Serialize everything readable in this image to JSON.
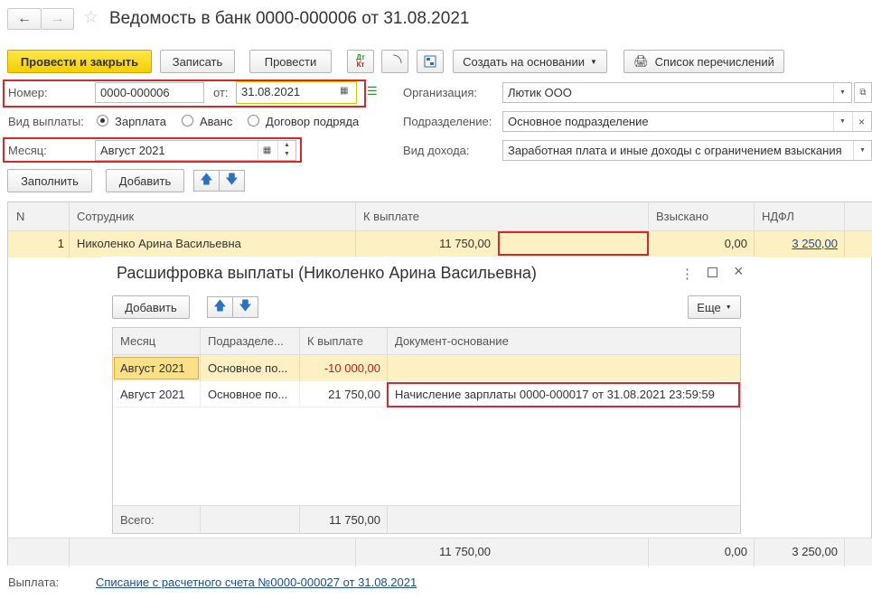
{
  "header": {
    "title": "Ведомость в банк 0000-000006 от 31.08.2021"
  },
  "toolbar": {
    "post_close": "Провести и закрыть",
    "save": "Записать",
    "post": "Провести",
    "dt_kt": "Дт Кт",
    "create_based": "Создать на основании",
    "transfer_list": "Список перечислений"
  },
  "form": {
    "number_label": "Номер:",
    "number_value": "0000-000006",
    "date_label": "от:",
    "date_value": "31.08.2021",
    "payment_type_label": "Вид выплаты:",
    "payment_options": [
      "Зарплата",
      "Аванс",
      "Договор подряда"
    ],
    "month_label": "Месяц:",
    "month_value": "Август 2021",
    "org_label": "Организация:",
    "org_value": "Лютик ООО",
    "dept_label": "Подразделение:",
    "dept_value": "Основное подразделение",
    "income_label": "Вид дохода:",
    "income_value": "Заработная плата и иные доходы с ограничением взыскания"
  },
  "tablebar": {
    "fill": "Заполнить",
    "add": "Добавить"
  },
  "main_table": {
    "headers": [
      "N",
      "Сотрудник",
      "К выплате",
      "Взыскано",
      "НДФЛ"
    ],
    "rows": [
      {
        "n": "1",
        "employee": "Николенко Арина Васильевна",
        "to_pay": "11 750,00",
        "collected": "0,00",
        "ndfl": "3 250,00"
      }
    ],
    "footer": {
      "to_pay": "11 750,00",
      "collected": "0,00",
      "ndfl": "3 250,00"
    }
  },
  "popup": {
    "title": "Расшифровка выплаты (Николенко Арина Васильевна)",
    "add": "Добавить",
    "more": "Еще",
    "headers": [
      "Месяц",
      "Подразделе...",
      "К выплате",
      "Документ-основание"
    ],
    "rows": [
      {
        "month": "Август 2021",
        "dept": "Основное по...",
        "to_pay": "-10 000,00",
        "doc": ""
      },
      {
        "month": "Август 2021",
        "dept": "Основное по...",
        "to_pay": "21 750,00",
        "doc": "Начисление зарплаты 0000-000017 от 31.08.2021 23:59:59"
      }
    ],
    "total_label": "Всего:",
    "total_value": "11 750,00"
  },
  "footer": {
    "payment_label": "Выплата:",
    "payment_link": "Списание с расчетного счета №0000-000027 от 31.08.2021"
  },
  "colors": {
    "accent_yellow": "#f6cf00",
    "row_highlight": "#fdf0c3",
    "red_outline": "#d6272c",
    "negative": "#c8161c",
    "link": "#1e4b8f"
  }
}
